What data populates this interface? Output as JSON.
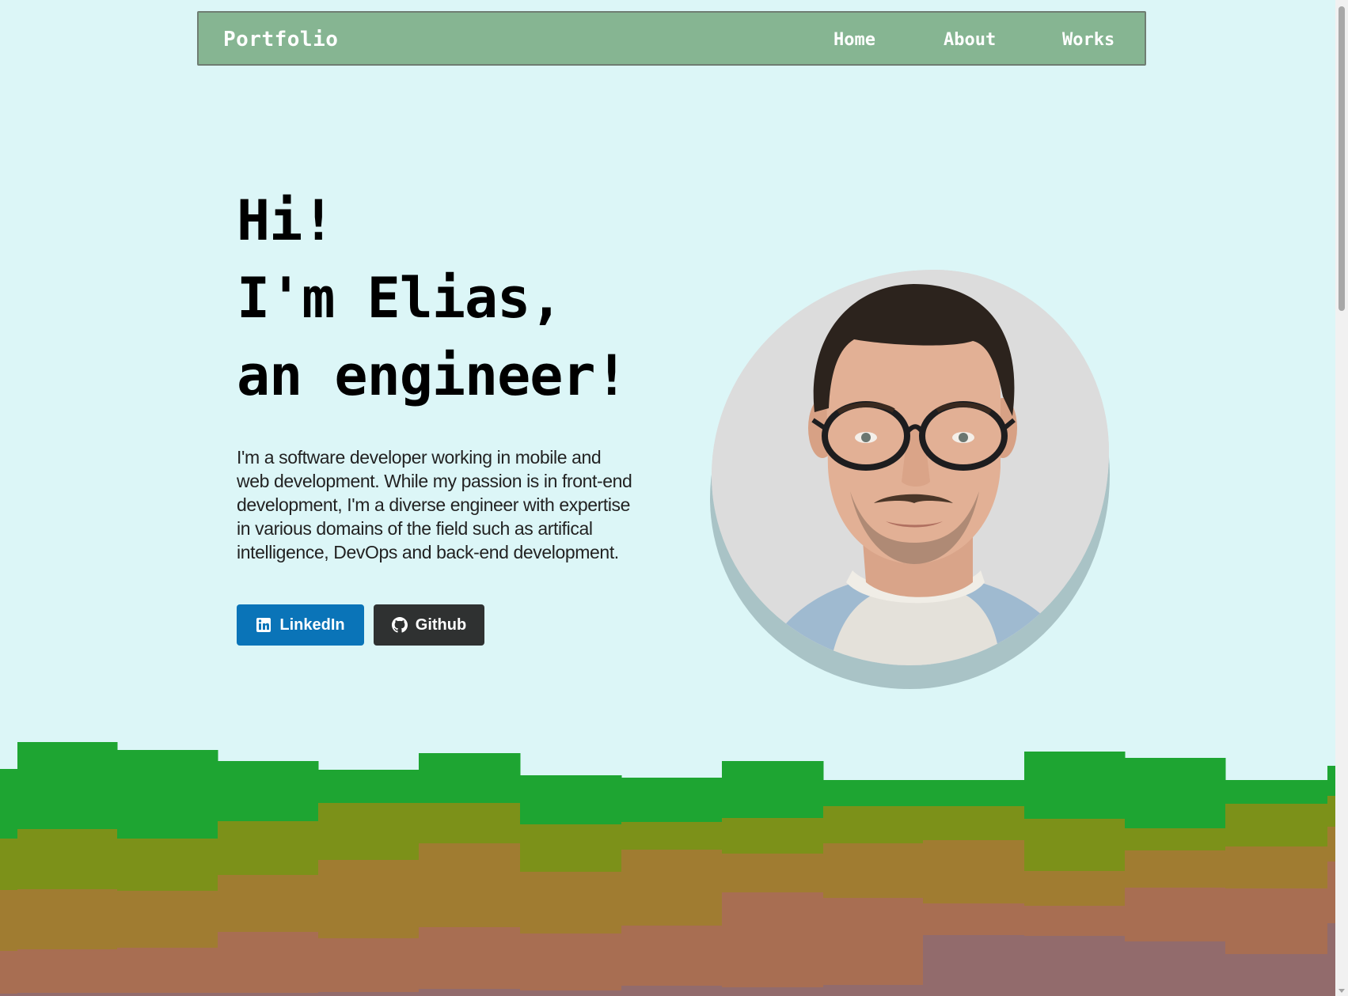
{
  "navbar": {
    "brand": "Portfolio",
    "links": [
      "Home",
      "About",
      "Works"
    ]
  },
  "hero": {
    "headline": [
      "Hi!",
      "I'm Elias,",
      "an engineer!"
    ],
    "bio": "I'm a software developer working in mobile and web development. While my passion is in front-end development, I'm a diverse engineer with expertise in various domains of the field such as artifical intelligence, DevOps and back-end development.",
    "buttons": {
      "linkedin": "LinkedIn",
      "github": "Github"
    }
  },
  "colors": {
    "background": "#dcf6f7",
    "navbar": "#86b592",
    "linkedin": "#0a74b8",
    "github": "#2f3131",
    "ground_layers": [
      "#1ea532",
      "#7c9119",
      "#a07c31",
      "#a86e52",
      "#926b6c"
    ]
  },
  "icons": {
    "linkedin": "linkedin-icon",
    "github": "github-icon"
  }
}
